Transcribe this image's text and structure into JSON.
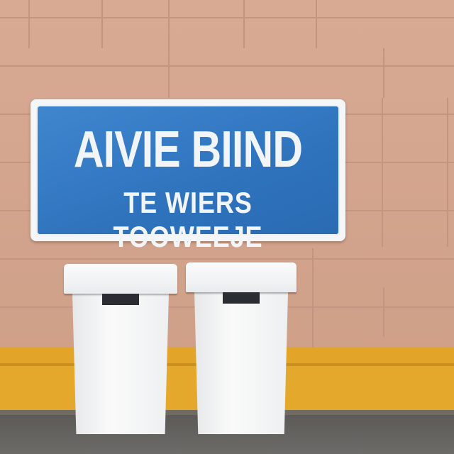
{
  "scene": "photo",
  "sign": {
    "line1": "AIVIE BIIND",
    "line2": "TE WIERS TOOWEEJE",
    "color": "#2f73bd"
  },
  "colors": {
    "wall": "#d6a892",
    "curb": "#e2a52a",
    "bins": "#f4f4f4"
  }
}
